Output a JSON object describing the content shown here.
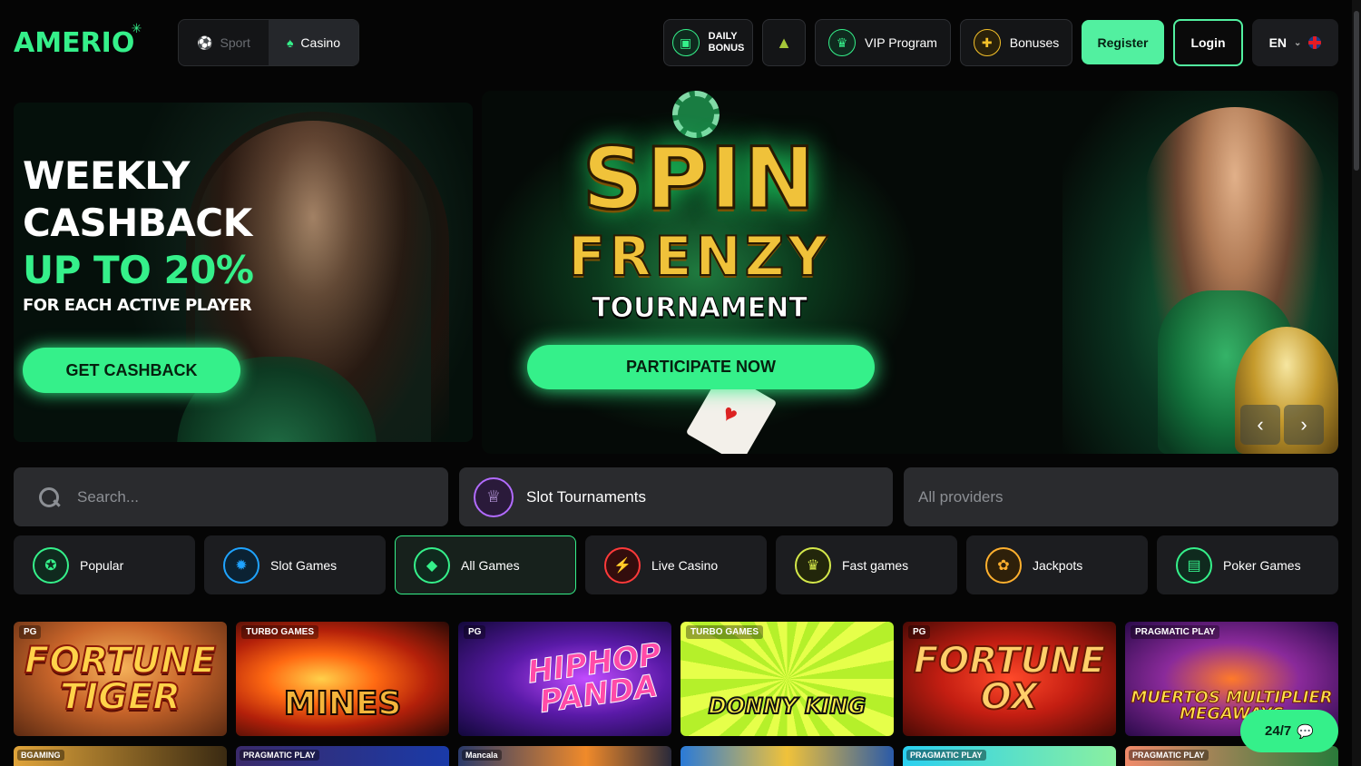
{
  "header": {
    "logo": "AMERIO",
    "modes": [
      {
        "label": "Sport",
        "icon": "soccer-ball-icon",
        "active": false
      },
      {
        "label": "Casino",
        "icon": "spade-icon",
        "active": true
      }
    ],
    "daily_bonus_line1": "DAILY",
    "daily_bonus_line2": "BONUS",
    "vip_label": "VIP Program",
    "bonuses_label": "Bonuses",
    "register_label": "Register",
    "login_label": "Login",
    "language": "EN"
  },
  "banners": {
    "left": {
      "line1": "WEEKLY",
      "line2": "CASHBACK",
      "line3": "UP TO 20%",
      "line4": "FOR EACH ACTIVE PLAYER",
      "cta": "GET CASHBACK"
    },
    "right": {
      "title1": "SPIN",
      "title2": "FRENZY",
      "title3": "TOURNAMENT",
      "cta": "PARTICIPATE NOW"
    }
  },
  "filters": {
    "search_placeholder": "Search...",
    "tournaments_label": "Slot Tournaments",
    "providers_label": "All providers"
  },
  "categories": [
    {
      "label": "Popular",
      "icon": "popular-icon"
    },
    {
      "label": "Slot Games",
      "icon": "slot-games-icon"
    },
    {
      "label": "All Games",
      "icon": "all-games-icon",
      "active": true
    },
    {
      "label": "Live Casino",
      "icon": "live-casino-icon"
    },
    {
      "label": "Fast games",
      "icon": "fast-games-icon"
    },
    {
      "label": "Jackpots",
      "icon": "jackpots-icon"
    },
    {
      "label": "Poker Games",
      "icon": "poker-games-icon"
    }
  ],
  "games": [
    {
      "title": "FORTUNE TIGER",
      "provider": "PG"
    },
    {
      "title": "MINES",
      "provider": "TURBO GAMES"
    },
    {
      "title": "HIPHOP PANDA",
      "provider": "PG"
    },
    {
      "title": "DONNY KING",
      "provider": "TURBO GAMES"
    },
    {
      "title": "FORTUNE OX",
      "provider": "PG"
    },
    {
      "title": "MUERTOS MULTIPLIER MEGAWAYS",
      "provider": "PRAGMATIC PLAY"
    }
  ],
  "games_row2": [
    {
      "provider": "BGAMING"
    },
    {
      "provider": "PRAGMATIC PLAY"
    },
    {
      "provider": "Mancala"
    },
    {
      "provider": ""
    },
    {
      "provider": "PRAGMATIC PLAY"
    },
    {
      "provider": "PRAGMATIC PLAY"
    }
  ],
  "support_label": "24/7",
  "colors": {
    "accent": "#35f08a",
    "background": "#050505",
    "panel": "#1c1d20"
  }
}
